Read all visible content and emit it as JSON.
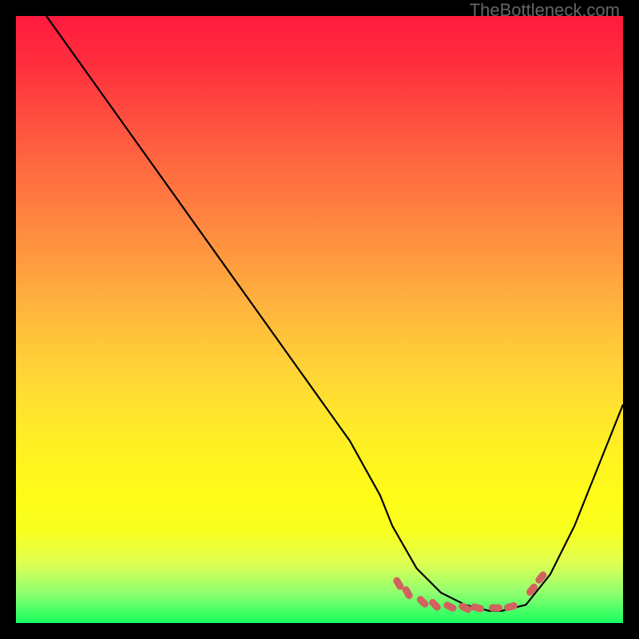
{
  "watermark": "TheBottleneck.com",
  "chart_data": {
    "type": "line",
    "title": "",
    "xlabel": "",
    "ylabel": "",
    "xlim": [
      0,
      100
    ],
    "ylim": [
      0,
      100
    ],
    "grid": false,
    "legend": false,
    "series": [
      {
        "name": "bottleneck-curve",
        "x": [
          5,
          10,
          15,
          20,
          25,
          30,
          35,
          40,
          45,
          50,
          55,
          60,
          62,
          66,
          70,
          74,
          78,
          80,
          84,
          88,
          92,
          96,
          100
        ],
        "values": [
          100,
          93,
          86,
          79,
          72,
          65,
          58,
          51,
          44,
          37,
          30,
          21,
          16,
          9,
          5,
          3,
          2,
          2,
          3,
          8,
          16,
          26,
          36
        ]
      }
    ],
    "markers": [
      {
        "x": 63.0,
        "y": 6.5
      },
      {
        "x": 64.5,
        "y": 5.0
      },
      {
        "x": 67.0,
        "y": 3.5
      },
      {
        "x": 69.0,
        "y": 3.0
      },
      {
        "x": 71.5,
        "y": 2.7
      },
      {
        "x": 74.0,
        "y": 2.5
      },
      {
        "x": 76.0,
        "y": 2.5
      },
      {
        "x": 79.0,
        "y": 2.5
      },
      {
        "x": 81.5,
        "y": 2.7
      },
      {
        "x": 85.0,
        "y": 5.5
      },
      {
        "x": 86.5,
        "y": 7.5
      }
    ],
    "gradient_stops": [
      {
        "pos": 0,
        "color": "#ff1a3e"
      },
      {
        "pos": 50,
        "color": "#ffc030"
      },
      {
        "pos": 85,
        "color": "#ffff18"
      },
      {
        "pos": 100,
        "color": "#18ff60"
      }
    ],
    "curve_color": "#000000",
    "marker_color": "#d2625f"
  }
}
